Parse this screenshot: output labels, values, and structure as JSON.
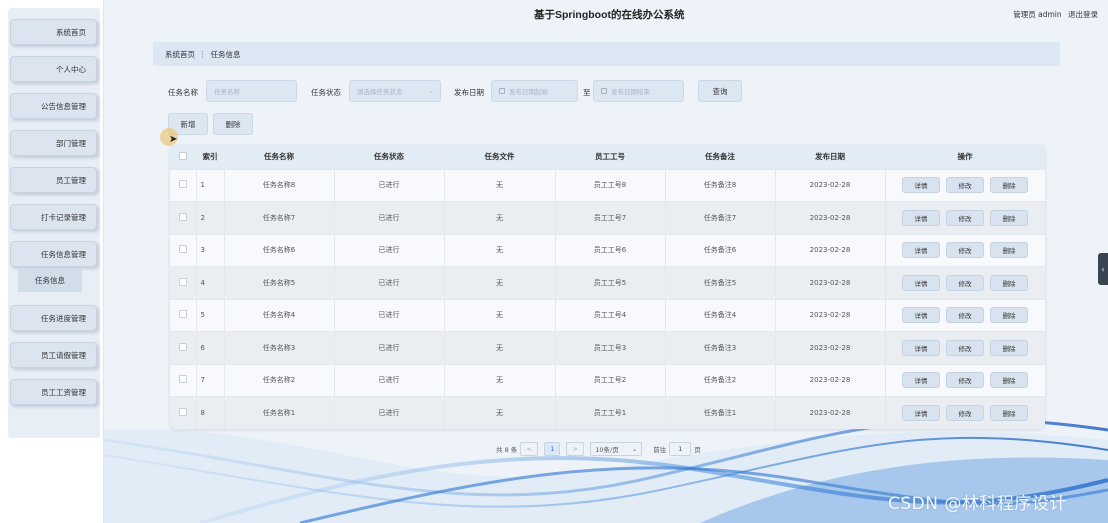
{
  "app": {
    "title": "基于Springboot的在线办公系统"
  },
  "user": {
    "role_name": "管理员 admin",
    "logout": "退出登录"
  },
  "sidebar": {
    "items": [
      {
        "label": "系统首页"
      },
      {
        "label": "个人中心"
      },
      {
        "label": "公告信息管理"
      },
      {
        "label": "部门管理"
      },
      {
        "label": "员工管理"
      },
      {
        "label": "打卡记录管理"
      },
      {
        "label": "任务信息管理"
      },
      {
        "label": "任务进度管理"
      },
      {
        "label": "员工请假管理"
      },
      {
        "label": "员工工资管理"
      }
    ],
    "sub_item": "任务信息"
  },
  "breadcrumb": {
    "home": "系统首页",
    "sep": "⋮",
    "current": "任务信息"
  },
  "search": {
    "name_label": "任务名称",
    "name_placeholder": "任务名称",
    "status_label": "任务状态",
    "status_placeholder": "请选择任务状态",
    "date_label": "发布日期",
    "date_start_placeholder": "发布日期起始",
    "date_to": "至",
    "date_end_placeholder": "发布日期结束",
    "query_button": "查询"
  },
  "actions": {
    "add": "新增",
    "delete": "删除"
  },
  "table": {
    "headers": [
      "索引",
      "任务名称",
      "任务状态",
      "任务文件",
      "员工工号",
      "任务备注",
      "发布日期",
      "操作"
    ],
    "rows": [
      {
        "index": "1",
        "name": "任务名称8",
        "status": "已进行",
        "file": "无",
        "emp_no": "员工工号8",
        "remark": "任务备注8",
        "date": "2023-02-28"
      },
      {
        "index": "2",
        "name": "任务名称7",
        "status": "已进行",
        "file": "无",
        "emp_no": "员工工号7",
        "remark": "任务备注7",
        "date": "2023-02-28"
      },
      {
        "index": "3",
        "name": "任务名称6",
        "status": "已进行",
        "file": "无",
        "emp_no": "员工工号6",
        "remark": "任务备注6",
        "date": "2023-02-28"
      },
      {
        "index": "4",
        "name": "任务名称5",
        "status": "已进行",
        "file": "无",
        "emp_no": "员工工号5",
        "remark": "任务备注5",
        "date": "2023-02-28"
      },
      {
        "index": "5",
        "name": "任务名称4",
        "status": "已进行",
        "file": "无",
        "emp_no": "员工工号4",
        "remark": "任务备注4",
        "date": "2023-02-28"
      },
      {
        "index": "6",
        "name": "任务名称3",
        "status": "已进行",
        "file": "无",
        "emp_no": "员工工号3",
        "remark": "任务备注3",
        "date": "2023-02-28"
      },
      {
        "index": "7",
        "name": "任务名称2",
        "status": "已进行",
        "file": "无",
        "emp_no": "员工工号2",
        "remark": "任务备注2",
        "date": "2023-02-28"
      },
      {
        "index": "8",
        "name": "任务名称1",
        "status": "已进行",
        "file": "无",
        "emp_no": "员工工号1",
        "remark": "任务备注1",
        "date": "2023-02-28"
      }
    ],
    "row_actions": {
      "detail": "详情",
      "edit": "修改",
      "delete": "删除"
    }
  },
  "pagination": {
    "total": "共 8 条",
    "prev": "<",
    "current_page": "1",
    "next": ">",
    "page_size": "10条/页",
    "goto_label": "前往",
    "goto_value": "1",
    "page_unit": "页"
  },
  "watermark": "CSDN @林科程序设计",
  "colors": {
    "accent": "#2a6fd6",
    "panel": "#dde7f2",
    "background": "#eef3f9"
  }
}
